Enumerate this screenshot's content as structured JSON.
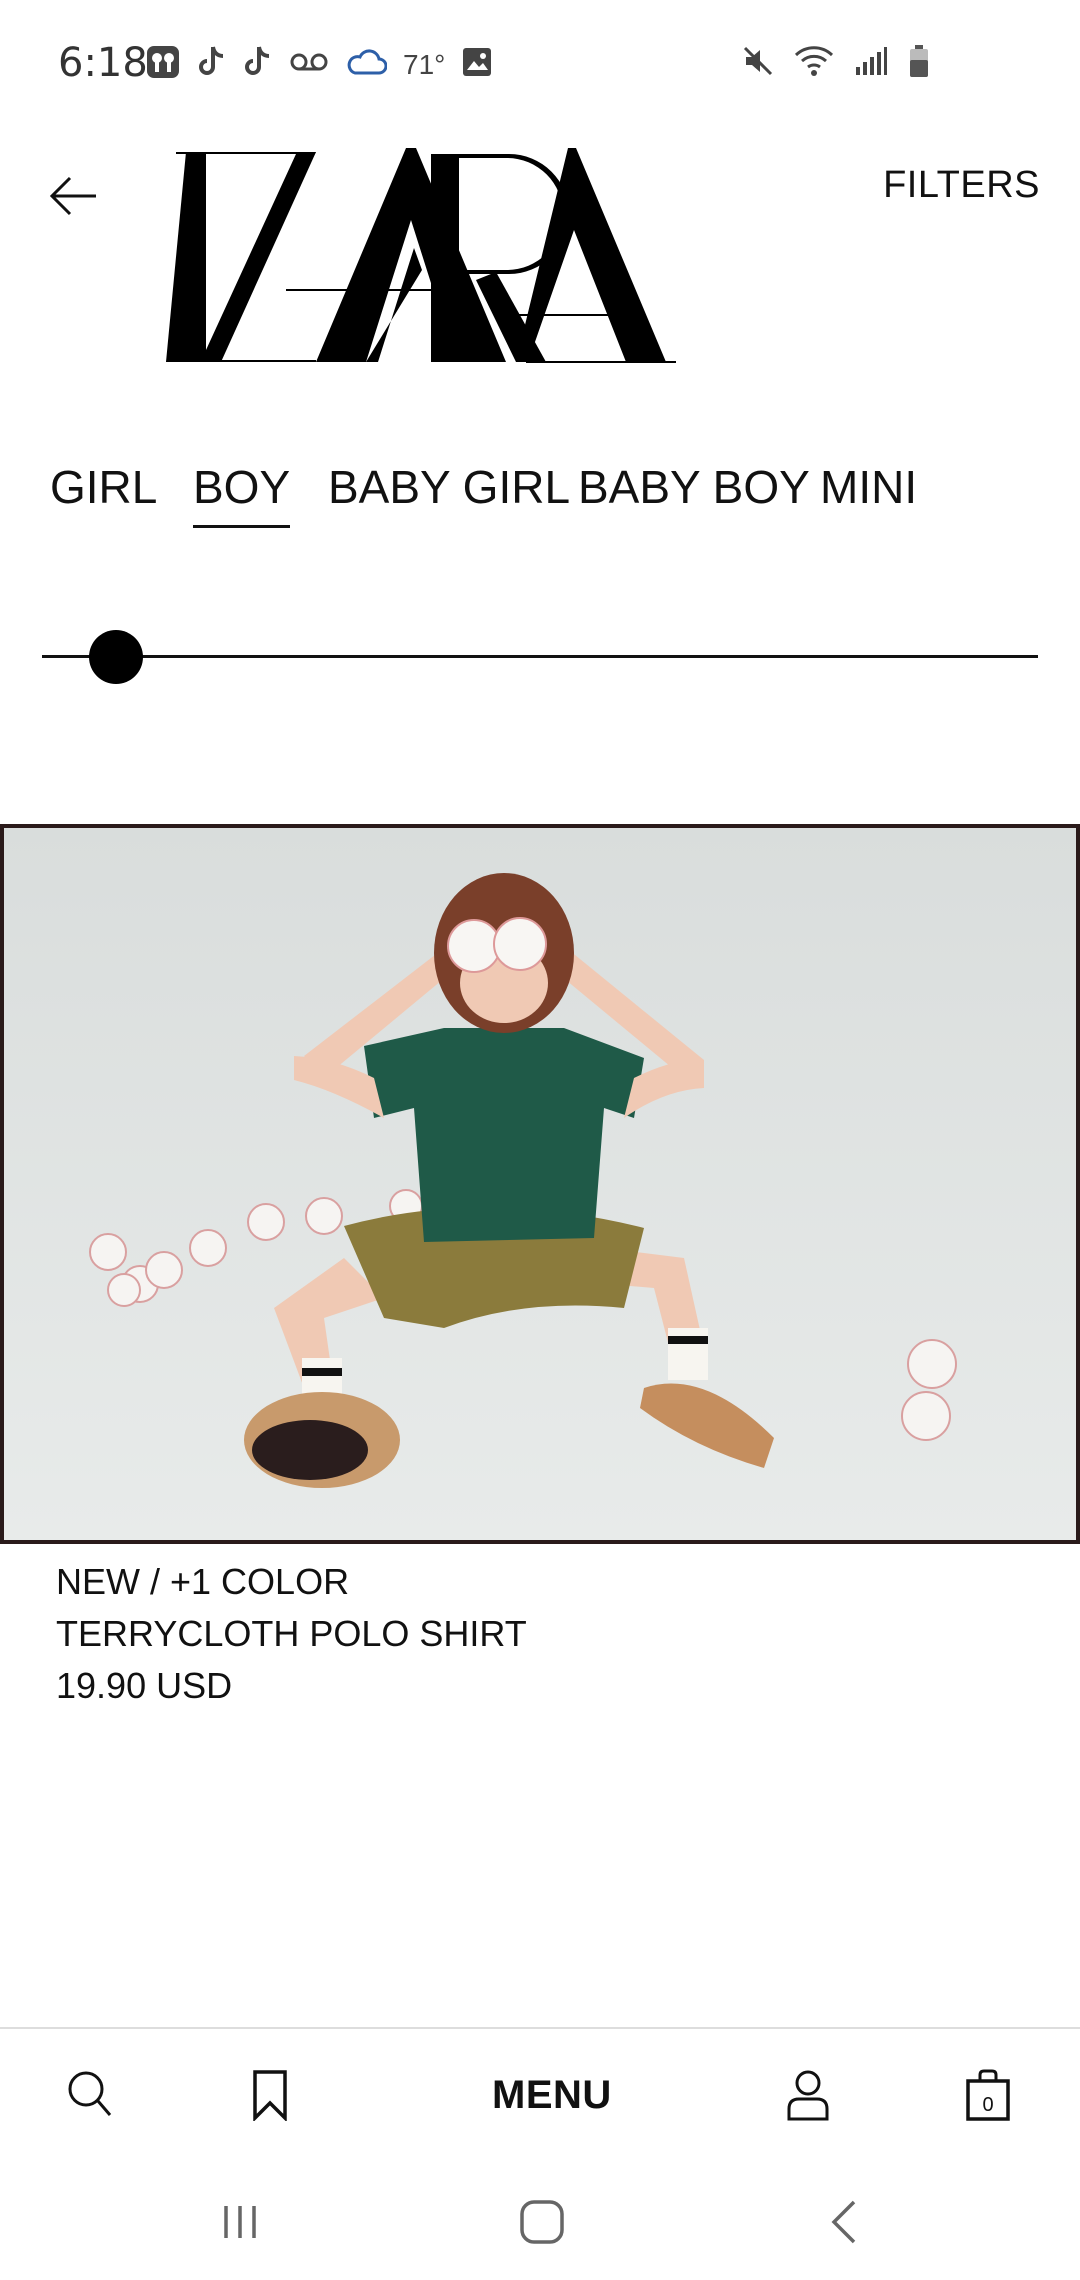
{
  "status_bar": {
    "time": "6:18",
    "temperature": "71°",
    "icons_left": [
      "airbuds-icon",
      "tiktok-icon",
      "tiktok-icon",
      "voicemail-icon",
      "cloud-icon",
      "image-icon"
    ],
    "icons_right": [
      "mute-icon",
      "wifi-icon",
      "signal-icon",
      "battery-icon"
    ]
  },
  "header": {
    "logo_text": "ZARA",
    "filters_label": "FILTERS"
  },
  "tabs": [
    {
      "label": "GIRL",
      "active": false
    },
    {
      "label": "BOY",
      "active": true
    },
    {
      "label": "BABY GIRL",
      "active": false
    },
    {
      "label": "BABY BOY",
      "active": false
    },
    {
      "label": "MINI",
      "active": false
    }
  ],
  "slider": {
    "value": 0.05
  },
  "product": {
    "badge": "NEW / +1 COLOR",
    "name": "TERRYCLOTH POLO SHIRT",
    "price": "19.90 USD"
  },
  "bottom_nav": {
    "menu_label": "MENU",
    "cart_count": "0"
  },
  "colors": {
    "text": "#111111",
    "image_border": "#2a1a1a",
    "image_bg": "#e4e7e6"
  }
}
